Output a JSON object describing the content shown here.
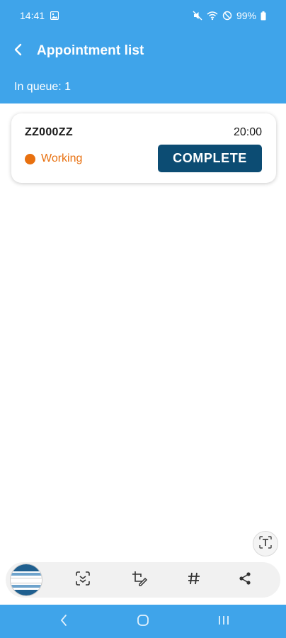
{
  "status_bar": {
    "time": "14:41",
    "battery": "99%",
    "icons": [
      "gallery-icon",
      "mute-icon",
      "wifi-icon",
      "dnd-icon",
      "battery-icon"
    ]
  },
  "header": {
    "title": "Appointment list",
    "back_icon": "chevron-left-icon"
  },
  "queue": {
    "label": "In queue: 1"
  },
  "appointments": [
    {
      "plate": "ZZ000ZZ",
      "time": "20:00",
      "status": "Working",
      "status_color": "#e8700f",
      "action_label": "COMPLETE"
    }
  ],
  "screenshot_toolbar": {
    "tools": [
      "scan-icon",
      "crop-edit-icon",
      "hashtag-icon",
      "share-icon"
    ],
    "text_extract_icon": "text-extract-icon"
  },
  "nav_bar": {
    "buttons": [
      "back-nav-icon",
      "home-nav-icon",
      "recents-nav-icon"
    ]
  },
  "colors": {
    "primary": "#3fa4ea",
    "button": "#0c4c73",
    "status_working": "#e8700f"
  }
}
